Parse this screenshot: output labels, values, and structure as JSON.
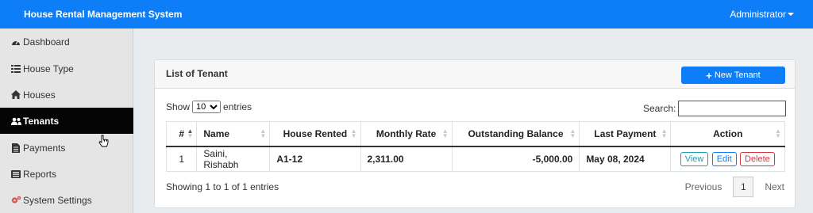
{
  "header": {
    "title": "House Rental Management System",
    "user": "Administrator"
  },
  "sidebar": {
    "items": [
      {
        "label": "Dashboard",
        "icon": "dashboard-icon"
      },
      {
        "label": "House Type",
        "icon": "list-icon"
      },
      {
        "label": "Houses",
        "icon": "home-icon"
      },
      {
        "label": "Tenants",
        "icon": "users-icon",
        "active": true
      },
      {
        "label": "Payments",
        "icon": "file-icon"
      },
      {
        "label": "Reports",
        "icon": "report-icon"
      },
      {
        "label": "System Settings",
        "icon": "cogs-icon"
      }
    ]
  },
  "panel": {
    "title": "List of Tenant",
    "new_button": "New Tenant"
  },
  "controls": {
    "show_label": "Show",
    "entries_label": "entries",
    "page_size": "10",
    "search_label": "Search:"
  },
  "table": {
    "headers": [
      "#",
      "Name",
      "House Rented",
      "Monthly Rate",
      "Outstanding Balance",
      "Last Payment",
      "Action"
    ],
    "rows": [
      {
        "no": "1",
        "name": "Saini, Rishabh",
        "house": "A1-12",
        "rate": "2,311.00",
        "balance": "-5,000.00",
        "last_payment": "May 08, 2024"
      }
    ],
    "actions": {
      "view": "View",
      "edit": "Edit",
      "delete": "Delete"
    }
  },
  "footer": {
    "info": "Showing 1 to 1 of 1 entries",
    "previous": "Previous",
    "page": "1",
    "next": "Next"
  },
  "colors": {
    "primary": "#0d7ef7",
    "sidebar_active": "#050505",
    "danger": "#dc3545",
    "info": "#17a2b8"
  }
}
